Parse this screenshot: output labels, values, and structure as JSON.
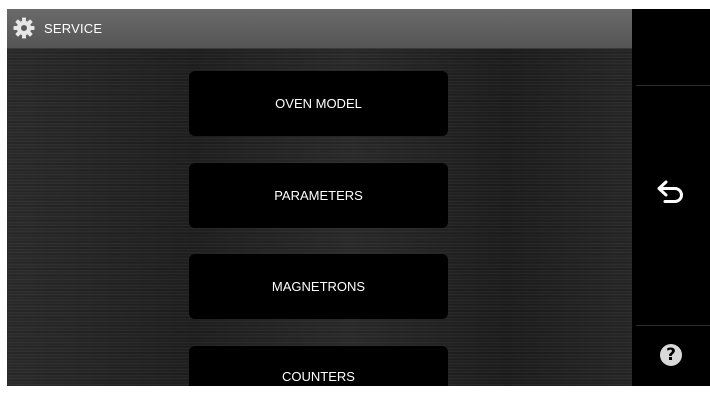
{
  "header": {
    "title": "SERVICE",
    "icon": "gear-icon"
  },
  "menu": {
    "items": [
      {
        "label": "OVEN MODEL"
      },
      {
        "label": "PARAMETERS"
      },
      {
        "label": "MAGNETRONS"
      },
      {
        "label": "COUNTERS"
      }
    ]
  },
  "sidebar": {
    "back_icon": "back-arrow-icon",
    "help_icon": "help-icon",
    "help_glyph": "?"
  },
  "colors": {
    "header_bg": "#5f5f5f",
    "button_bg": "#000000",
    "text": "#ffffff"
  }
}
